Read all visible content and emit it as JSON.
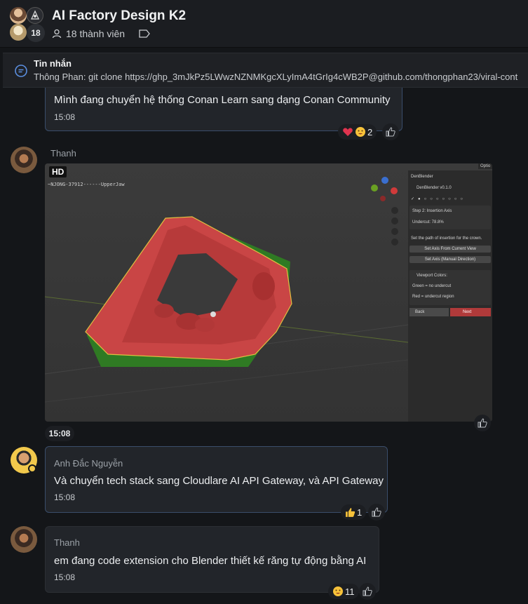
{
  "header": {
    "title": "AI Factory Design K2",
    "member_count": "18",
    "members_label": "18 thành viên"
  },
  "pinned": {
    "title": "Tin nhắn",
    "text": "Thông Phan: git clone https://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@github.com/thongphan23/viral-cont"
  },
  "messages": [
    {
      "text": "Mình đang chuyển hệ thống Conan Learn sang dạng Conan Community",
      "time": "15:08",
      "reaction_count": "2"
    },
    {
      "sender": "Thanh",
      "time": "15:08",
      "image": {
        "hd": "HD",
        "label": "~NJONG-37912------UpperJaw",
        "option_btn": "Optio",
        "panel_title": "DenBlender",
        "version": "DenBlender v0.1.0",
        "step": "Step 2: Insertion Axis",
        "undercut": "Undercut: 78.8%",
        "instruction": "Set the path of insertion for the crown.",
        "btn_current_view": "Set Axis From Current View",
        "btn_manual": "Set Axis (Manual Direction)",
        "colors_title": "Viewport Colors:",
        "green_label": "Green = no undercut",
        "red_label": "Red = undercut region",
        "back": "Back",
        "next": "Next"
      }
    },
    {
      "sender": "Anh Đắc Nguyễn",
      "text": "Và chuyển tech stack sang Cloudlare AI API Gateway, và API Gateway",
      "time": "15:08",
      "reaction_count": "1"
    },
    {
      "sender": "Thanh",
      "text": "em đang code extension cho Blender thiết kế răng tự động bằng AI",
      "time": "15:08",
      "reaction_count": "11"
    }
  ],
  "colors": {
    "background": "#141619",
    "bubble": "#22252a",
    "bubble_border_active": "#3a4d6a",
    "model_red": "#c94a4a",
    "model_green": "#3a8a2a"
  }
}
